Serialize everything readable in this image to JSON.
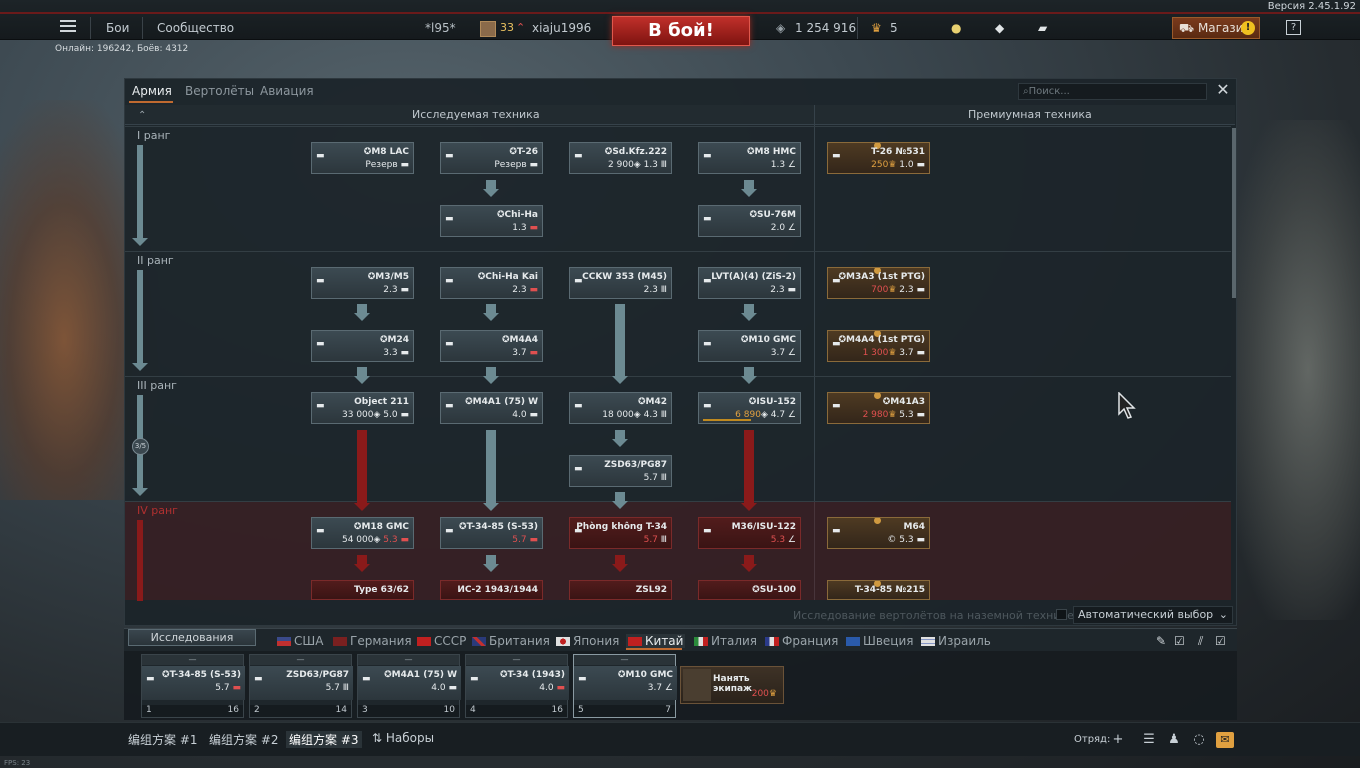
{
  "version": "Версия 2.45.1.92",
  "topbar": {
    "battles": "Бои",
    "community": "Сообщество",
    "clan_tag": "*l95*",
    "level": "33",
    "username": "xiaju1996",
    "fight": "В бой!",
    "silver": "1 254 916",
    "gold": "5",
    "shop": "Магазин",
    "shop_warn": "!",
    "help": "?"
  },
  "online": "Онлайн: 196242, Боёв: 4312",
  "tabs": [
    "Армия",
    "Вертолёты",
    "Авиация"
  ],
  "search_placeholder": "Поиск...",
  "close": "✕",
  "headers": {
    "research": "Исследуемая техника",
    "premium": "Премиумная техника"
  },
  "ranks": [
    "I ранг",
    "II ранг",
    "III ранг",
    "IV ранг"
  ],
  "rank3_progress": "3/5",
  "vehicles": {
    "m8lac": {
      "name": "M8 LAC",
      "br": "Резерв"
    },
    "t26": {
      "name": "T-26",
      "br": "Резерв"
    },
    "sdkfz": {
      "name": "Sd.Kfz.222",
      "cost": "2 900",
      "br": "1.3"
    },
    "m8hmc": {
      "name": "M8 HMC",
      "br": "1.3"
    },
    "t26prem": {
      "name": "T-26 №531",
      "cost": "250",
      "br": "1.0"
    },
    "chiha": {
      "name": "Chi-Ha",
      "br": "1.3"
    },
    "su76m": {
      "name": "SU-76M",
      "br": "2.0"
    },
    "m3m5": {
      "name": "M3/M5",
      "br": "2.3"
    },
    "chihakai": {
      "name": "Chi-Ha Kai",
      "br": "2.3"
    },
    "cckw": {
      "name": "CCKW 353 (M45)",
      "br": "2.3"
    },
    "lvt": {
      "name": "LVT(A)(4) (ZiS-2)",
      "br": "2.3"
    },
    "m3a3": {
      "name": "M3A3 (1st PTG)",
      "cost": "700",
      "br": "2.3"
    },
    "m24": {
      "name": "M24",
      "br": "3.3"
    },
    "m4a4": {
      "name": "M4A4",
      "br": "3.7"
    },
    "m10": {
      "name": "M10 GMC",
      "br": "3.7"
    },
    "m4a4prem": {
      "name": "M4A4 (1st PTG)",
      "cost": "1 300",
      "br": "3.7"
    },
    "obj211": {
      "name": "Object 211",
      "cost": "33 000",
      "br": "5.0"
    },
    "m4a175": {
      "name": "M4A1 (75) W",
      "br": "4.0"
    },
    "m42": {
      "name": "M42",
      "cost": "18 000",
      "br": "4.3"
    },
    "isu152": {
      "name": "ISU-152",
      "cost": "6 890",
      "br": "4.7"
    },
    "m41a3": {
      "name": "M41A3",
      "cost": "2 980",
      "br": "5.3"
    },
    "zsd63": {
      "name": "ZSD63/PG87",
      "br": "5.7"
    },
    "m18": {
      "name": "M18 GMC",
      "cost": "54 000",
      "br": "5.3"
    },
    "t3485": {
      "name": "T-34-85 (S-53)",
      "br": "5.7"
    },
    "t34aa": {
      "name": "Phòng không T-34",
      "br": "5.7"
    },
    "m36": {
      "name": "M36/ISU-122",
      "br": "5.3"
    },
    "m64": {
      "name": "M64",
      "br": "5.3"
    },
    "type63": {
      "name": "Type 63/62"
    },
    "is2": {
      "name": "ИС-2 1943/1944"
    },
    "zsl92": {
      "name": "ZSL92"
    },
    "su100": {
      "name": "SU-100"
    },
    "t3485prem": {
      "name": "T-34-85 №215"
    }
  },
  "options": {
    "heli_research": "Исследование вертолётов на наземной технике",
    "auto_select": "Автоматический выбор"
  },
  "research_btn": "Исследования",
  "nations": [
    "США",
    "Германия",
    "СССР",
    "Британия",
    "Япония",
    "Китай",
    "Италия",
    "Франция",
    "Швеция",
    "Израиль"
  ],
  "crew": [
    {
      "cap": "—",
      "name": "T-34-85 (S-53)",
      "br": "5.7",
      "num": "1",
      "lvl": "16"
    },
    {
      "cap": "—",
      "name": "ZSD63/PG87",
      "br": "5.7",
      "num": "2",
      "lvl": "14"
    },
    {
      "cap": "—",
      "name": "M4A1 (75) W",
      "br": "4.0",
      "num": "3",
      "lvl": "10"
    },
    {
      "cap": "—",
      "name": "T-34 (1943)",
      "br": "4.0",
      "num": "4",
      "lvl": "16"
    },
    {
      "cap": "—",
      "name": "M10 GMC",
      "br": "3.7",
      "num": "5",
      "lvl": "7"
    }
  ],
  "hire": {
    "label": "Нанять экипаж",
    "cost": "200"
  },
  "presets": [
    "编组方案 #1",
    "编组方案 #2",
    "编组方案 #3",
    "Наборы"
  ],
  "squad": "Отряд:",
  "fps": "FPS: 23",
  "colors": {
    "accent": "#c06a30",
    "fight": "#c0302a",
    "locked": "#8a1a1a",
    "link": "#6c8a92"
  }
}
